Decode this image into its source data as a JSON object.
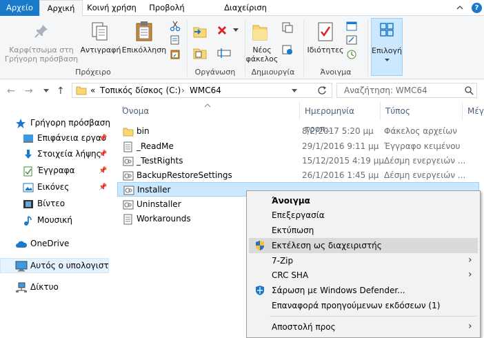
{
  "tabs": {
    "file": "Αρχείο",
    "home": "Αρχική",
    "share": "Κοινή χρήση",
    "view": "Προβολή",
    "manage": "Διαχείριση"
  },
  "ribbon": {
    "pin_line1": "Καρφίτσωμα στη",
    "pin_line2": "Γρήγορη πρόσβαση",
    "copy": "Αντιγραφή",
    "paste": "Επικόλληση",
    "new_folder_line1": "Νέος",
    "new_folder_line2": "φάκελος",
    "properties": "Ιδιότητες",
    "select": "Επιλογή",
    "groups": {
      "clipboard": "Πρόχειρο",
      "organize": "Οργάνωση",
      "new": "Δημιουργία",
      "open": "Άνοιγμα"
    }
  },
  "address": {
    "prefix": "«",
    "drive": "Τοπικός δίσκος (C:)",
    "folder": "WMC64",
    "search_placeholder": "Αναζήτηση: WMC64"
  },
  "nav": {
    "quick_access": "Γρήγορη πρόσβαση",
    "desktop": "Επιφάνεια εργασ",
    "downloads": "Στοιχεία λήψης",
    "documents": "Έγγραφα",
    "pictures": "Εικόνες",
    "videos": "Βίντεο",
    "music": "Μουσική",
    "onedrive": "OneDrive",
    "this_pc": "Αυτός ο υπολογιστ",
    "network": "Δίκτυο"
  },
  "columns": {
    "name": "Όνομα",
    "date": "Ημερομηνία τροπ...",
    "type": "Τύπος",
    "size": "Μέγ"
  },
  "files": [
    {
      "name": "bin",
      "date": "8/2/2017 5:20 μμ",
      "type": "Φάκελος αρχείων"
    },
    {
      "name": "_ReadMe",
      "date": "29/1/2016 9:11 μμ",
      "type": "Έγγραφο κειμένου"
    },
    {
      "name": "_TestRights",
      "date": "15/12/2015 4:19 μμ",
      "type": "Δέσμη ενεργειών ..."
    },
    {
      "name": "BackupRestoreSettings",
      "date": "26/1/2016 1:45 μμ",
      "type": "Δέσμη ενεργειών ..."
    },
    {
      "name": "Installer",
      "date": "",
      "type": ""
    },
    {
      "name": "Uninstaller",
      "date": "",
      "type": ""
    },
    {
      "name": "Workarounds",
      "date": "",
      "type": ""
    }
  ],
  "context_menu": {
    "open": "Άνοιγμα",
    "edit": "Επεξεργασία",
    "print": "Εκτύπωση",
    "run_as_admin": "Εκτέλεση ως διαχειριστής",
    "seven_zip": "7-Zip",
    "crc_sha": "CRC SHA",
    "defender": "Σάρωση με Windows Defender...",
    "restore": "Επαναφορά προηγούμενων εκδόσεων (1)",
    "send_to": "Αποστολή προς"
  }
}
